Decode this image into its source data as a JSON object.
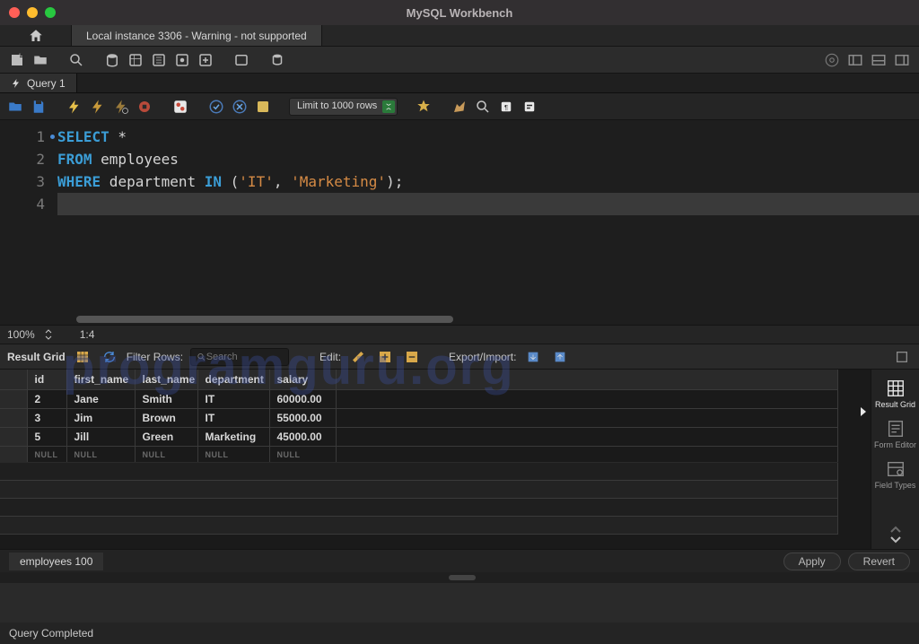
{
  "window": {
    "title": "MySQL Workbench"
  },
  "connection_tab": "Local instance 3306 - Warning - not supported",
  "query_tab": "Query 1",
  "editor": {
    "zoom": "100%",
    "position": "1:4",
    "lines": {
      "l1": {
        "select": "SELECT",
        "star": " *"
      },
      "l2": {
        "from": "FROM",
        "tbl": " employees"
      },
      "l3": {
        "where": "WHERE",
        "col": " department ",
        "in": "IN",
        "open": " (",
        "s1": "'IT'",
        "comma": ", ",
        "s2": "'Marketing'",
        "close": ");"
      }
    }
  },
  "limit_select": "Limit to 1000 rows",
  "result_header": {
    "title": "Result Grid",
    "filter_label": "Filter Rows:",
    "search_placeholder": "Search",
    "edit_label": "Edit:",
    "export_label": "Export/Import:"
  },
  "columns": [
    "id",
    "first_name",
    "last_name",
    "department",
    "salary"
  ],
  "rows": [
    {
      "id": "2",
      "first_name": "Jane",
      "last_name": "Smith",
      "department": "IT",
      "salary": "60000.00"
    },
    {
      "id": "3",
      "first_name": "Jim",
      "last_name": "Brown",
      "department": "IT",
      "salary": "55000.00"
    },
    {
      "id": "5",
      "first_name": "Jill",
      "last_name": "Green",
      "department": "Marketing",
      "salary": "45000.00"
    }
  ],
  "null_label": "NULL",
  "side": {
    "result_grid": "Result Grid",
    "form_editor": "Form Editor",
    "field_types": "Field Types"
  },
  "apply_tab": "employees 100",
  "buttons": {
    "apply": "Apply",
    "revert": "Revert"
  },
  "status": "Query Completed",
  "watermark": "programguru.org"
}
